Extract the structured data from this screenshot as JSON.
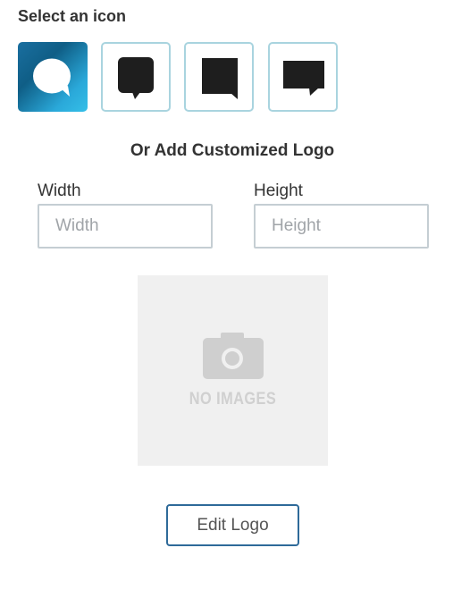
{
  "icon_picker": {
    "title": "Select an icon",
    "options": [
      {
        "icon": "chat-bubble-round-icon",
        "selected": true
      },
      {
        "icon": "chat-bubble-rounded-square-icon",
        "selected": false
      },
      {
        "icon": "chat-bubble-square-icon",
        "selected": false
      },
      {
        "icon": "chat-bubble-wide-icon",
        "selected": false
      }
    ],
    "colors": {
      "selected_bg": "#1a6fa0",
      "outline": "#a9d4df",
      "glyph": "#1e1e1e"
    }
  },
  "custom_logo": {
    "title": "Or Add Customized Logo",
    "width": {
      "label": "Width",
      "placeholder": "Width",
      "value": ""
    },
    "height": {
      "label": "Height",
      "placeholder": "Height",
      "value": ""
    },
    "preview": {
      "icon": "camera-icon",
      "text": "NO IMAGES"
    },
    "edit_button_label": "Edit Logo"
  }
}
